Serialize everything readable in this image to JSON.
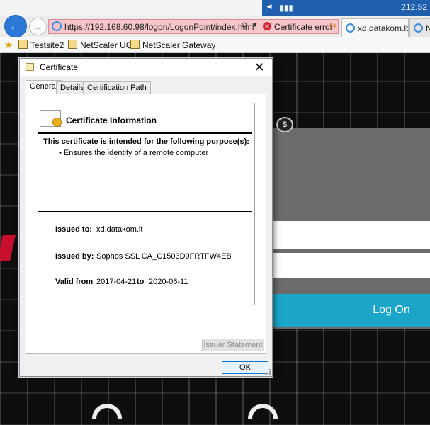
{
  "browser": {
    "address": {
      "url": "https://192.168.60.98/logon/LogonPoint/index.html",
      "cert_error": "Certificate error"
    },
    "tabs": [
      {
        "label": "xd.datakom.lt"
      },
      {
        "label": "Ne"
      }
    ],
    "favorites": [
      "Testsite2",
      "NetScaler UG",
      "NetScaler Gateway"
    ],
    "taskbar_ip": "212.52"
  },
  "page": {
    "logon_label": "Log On"
  },
  "dialog": {
    "title": "Certificate",
    "tabs": [
      "General",
      "Details",
      "Certification Path"
    ],
    "info_title": "Certificate Information",
    "purpose_heading": "This certificate is intended for the following purpose(s):",
    "purpose_items": [
      "• Ensures the identity of a remote computer"
    ],
    "issued_to_label": "Issued to:",
    "issued_to": "xd.datakom.lt",
    "issued_by_label": "Issued by:",
    "issued_by": "Sophos SSL CA_C1503D9FRTFW4EB",
    "valid_from_label": "Valid from",
    "valid_from": "2017-04-21",
    "to_label": "to",
    "valid_to": "2020-06-11",
    "issuer_statement_label": "Issuer Statement",
    "ok_label": "OK"
  },
  "colors": {
    "address_error_bg": "#f6c6cb",
    "logon_button": "#1ba6c9",
    "taskbar": "#1f5fae"
  },
  "icons": [
    "back-arrow-icon",
    "forward-arrow-icon",
    "ie-icon",
    "search-icon",
    "certificate-error-icon",
    "reload-icon",
    "favorites-star-icon",
    "certificate-icon",
    "close-icon"
  ]
}
